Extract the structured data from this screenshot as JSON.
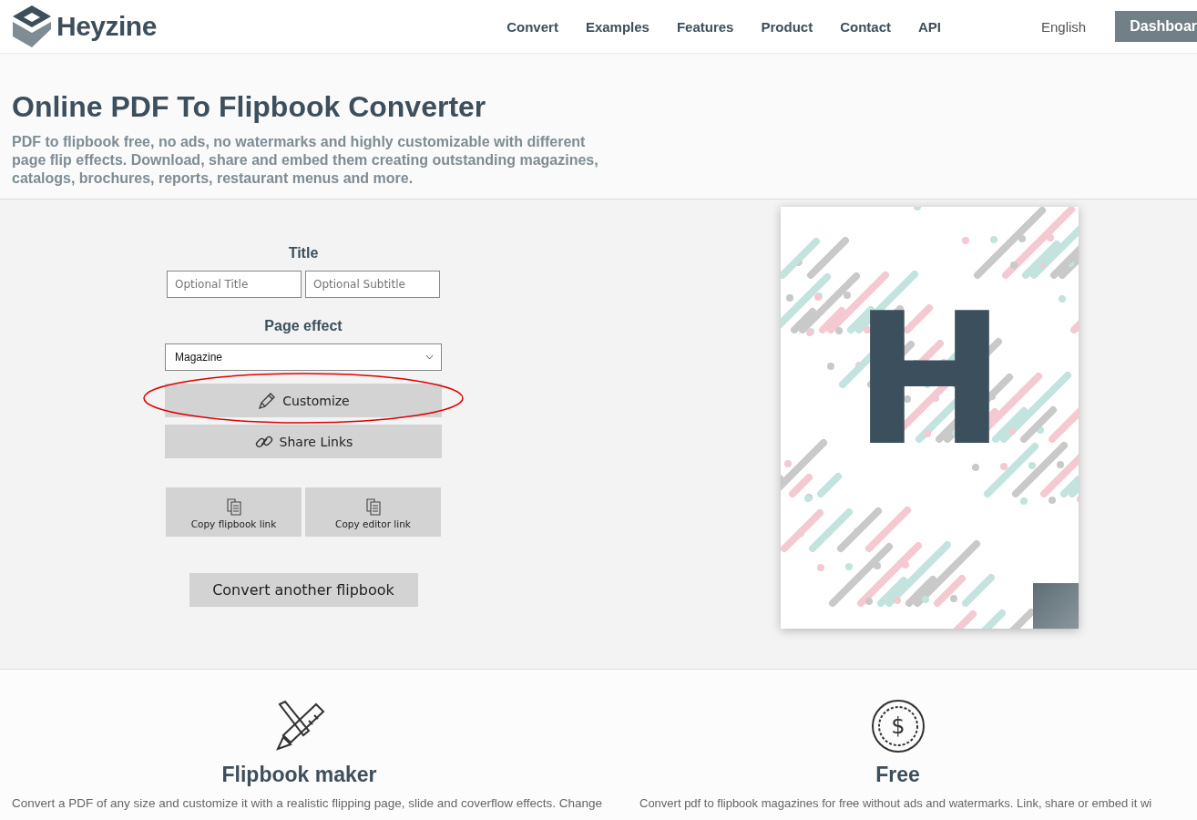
{
  "header": {
    "logo": "Heyzine",
    "nav": [
      {
        "label": "Convert"
      },
      {
        "label": "Examples"
      },
      {
        "label": "Features"
      },
      {
        "label": "Product"
      },
      {
        "label": "Contact"
      },
      {
        "label": "API"
      }
    ],
    "language": "English",
    "dashboard": "Dashboar"
  },
  "hero": {
    "title": "Online PDF To Flipbook Converter",
    "subtitle": "PDF to flipbook free, no ads, no watermarks and highly customizable with different page flip effects. Download, share and embed them creating outstanding magazines, catalogs, brochures, reports, restaurant menus and more."
  },
  "form": {
    "title_heading": "Title",
    "title_placeholder": "Optional Title",
    "subtitle_placeholder": "Optional Subtitle",
    "effect_heading": "Page effect",
    "effect_value": "Magazine",
    "buttons": [
      {
        "label": "Customize",
        "kind": "pencil",
        "highlighted": true
      },
      {
        "label": "Share Links",
        "kind": "links",
        "highlighted": false
      }
    ],
    "copy_buttons": [
      {
        "label": "Copy flipbook link"
      },
      {
        "label": "Copy editor link"
      }
    ],
    "convert_another": "Convert another flipbook"
  },
  "cover": {
    "letter": "H"
  },
  "features": [
    {
      "kind": "maker",
      "title": "Flipbook maker",
      "text": "Convert a PDF of any size and customize it with a realistic flipping page, slide and coverflow effects. Change"
    },
    {
      "kind": "free",
      "icon_text": "$",
      "title": "Free",
      "text": "Convert pdf to flipbook magazines for free without ads and watermarks. Link, share or embed it wi"
    }
  ]
}
